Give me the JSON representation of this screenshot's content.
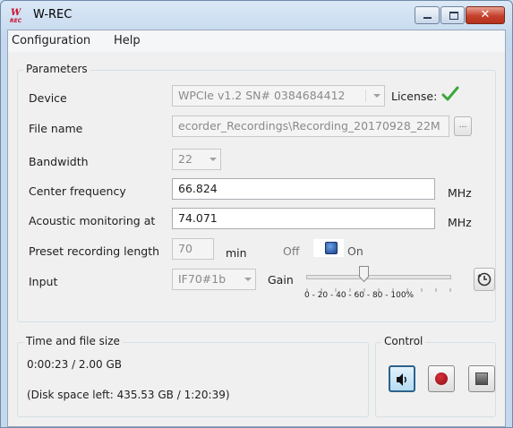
{
  "window": {
    "title": "W-REC",
    "icon_text": "W\nREC",
    "close_glyph": "✕"
  },
  "menu": {
    "items": [
      "Configuration",
      "Help"
    ]
  },
  "parameters": {
    "legend": "Parameters",
    "device_label": "Device",
    "device_value": "WPCIe v1.2 SN# 0384684412",
    "license_label": "License:",
    "filename_label": "File name",
    "filename_value": "ecorder_Recordings\\Recording_20170928_22M",
    "browse_label": "...",
    "bandwidth_label": "Bandwidth",
    "bandwidth_value": "22",
    "center_freq_label": "Center frequency",
    "center_freq_value": "66.824",
    "center_freq_unit": "MHz",
    "acoustic_label": "Acoustic monitoring at",
    "acoustic_value": "74.071",
    "acoustic_unit": "MHz",
    "preset_label": "Preset recording length",
    "preset_value": "70",
    "preset_unit": "min",
    "toggle_off": "Off",
    "toggle_on": "On",
    "toggle_state": "on",
    "input_label": "Input",
    "input_value": "IF70#1b",
    "gain_label": "Gain",
    "gain_scale": "0 - 20 - 40 - 60 - 80 - 100%",
    "gain_value_percent": 40
  },
  "time_group": {
    "legend": "Time and file size",
    "elapsed": "0:00:23 / 2.00 GB",
    "disk": "(Disk space left: 435.53 GB / 1:20:39)"
  },
  "control_group": {
    "legend": "Control"
  },
  "colors": {
    "accent": "#2c628b",
    "license_ok": "#3aa63a",
    "record": "#c81e28",
    "title_bg": "#c5d9ee"
  }
}
